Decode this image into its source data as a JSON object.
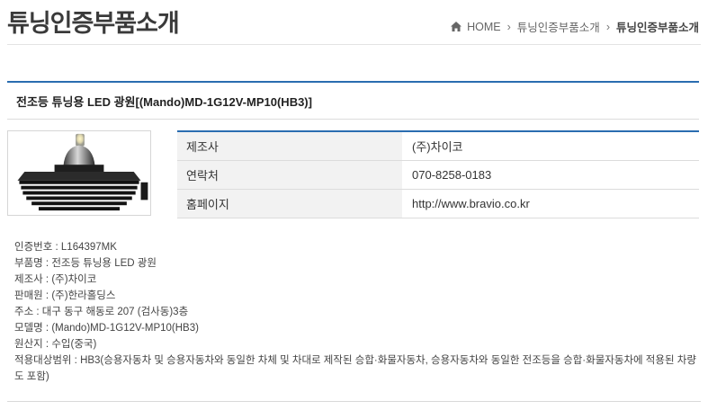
{
  "page": {
    "title": "튜닝인증부품소개"
  },
  "breadcrumb": {
    "home": "HOME",
    "level1": "튜닝인증부품소개",
    "current": "튜닝인증부품소개"
  },
  "product": {
    "title": "전조등 튜닝용 LED 광원[(Mando)MD-1G12V-MP10(HB3)]"
  },
  "info_table": [
    {
      "label": "제조사",
      "value": "(주)차이코"
    },
    {
      "label": "연락처",
      "value": "070-8258-0183"
    },
    {
      "label": "홈페이지",
      "value": "http://www.bravio.co.kr"
    }
  ],
  "details": [
    "인증번호 : L164397MK",
    "부품명 : 전조등 튜닝용 LED 광원",
    "제조사 : (주)차이코",
    "판매원 : (주)한라홀딩스",
    "주소 : 대구 동구 해동로 207 (검사동)3층",
    "모델명 : (Mando)MD-1G12V-MP10(HB3)",
    "원산지 : 수입(중국)",
    "적용대상범위 : HB3(승용자동차 및 승용자동차와 동일한 차체 및 차대로 제작된 승합·화물자동차, 승용자동차와 동일한 전조등을 승합·화물자동차에 적용된 차량도 포함)"
  ],
  "colors": {
    "accent": "#2a6db0",
    "label_bg": "#f2f2f2"
  }
}
